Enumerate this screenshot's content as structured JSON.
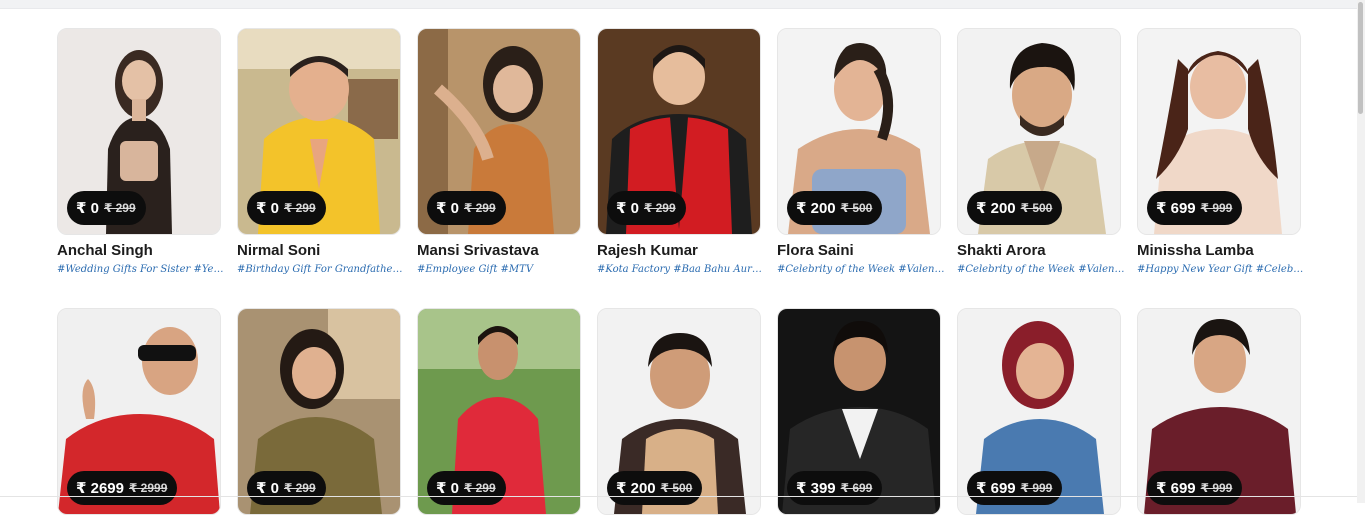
{
  "currency_symbol": "₹",
  "celebrities_row1": [
    {
      "name": "Anchal Singh",
      "price": "₹ 0",
      "original_price": "₹ 299",
      "tags": "#Wedding Gifts For Sister #Yeh Ka..."
    },
    {
      "name": "Nirmal Soni",
      "price": "₹ 0",
      "original_price": "₹ 299",
      "tags": "#Birthday Gift For Grandfather ..."
    },
    {
      "name": "Mansi Srivastava",
      "price": "₹ 0",
      "original_price": "₹ 299",
      "tags": "#Employee Gift #MTV"
    },
    {
      "name": "Rajesh Kumar",
      "price": "₹ 0",
      "original_price": "₹ 299",
      "tags": "#Kota Factory #Baa Bahu Aur Ba..."
    },
    {
      "name": "Flora Saini",
      "price": "₹ 200",
      "original_price": "₹ 500",
      "tags": "#Celebrity of the Week #Valentin..."
    },
    {
      "name": "Shakti Arora",
      "price": "₹ 200",
      "original_price": "₹ 500",
      "tags": "#Celebrity of the Week #Valentin..."
    },
    {
      "name": "Minissha Lamba",
      "price": "₹ 699",
      "original_price": "₹ 999",
      "tags": "#Happy New Year Gift #Celebrity ..."
    }
  ],
  "celebrities_row2": [
    {
      "price": "₹ 2699",
      "original_price": "₹ 2999"
    },
    {
      "price": "₹ 0",
      "original_price": "₹ 299"
    },
    {
      "price": "₹ 0",
      "original_price": "₹ 299"
    },
    {
      "price": "₹ 200",
      "original_price": "₹ 500"
    },
    {
      "price": "₹ 399",
      "original_price": "₹ 699"
    },
    {
      "price": "₹ 699",
      "original_price": "₹ 999"
    },
    {
      "price": "₹ 699",
      "original_price": "₹ 999"
    }
  ],
  "colors": {
    "price_pill_bg": "#0d0d0d",
    "tag_text": "#2a6bb0",
    "name_text": "#1c1c1c"
  }
}
